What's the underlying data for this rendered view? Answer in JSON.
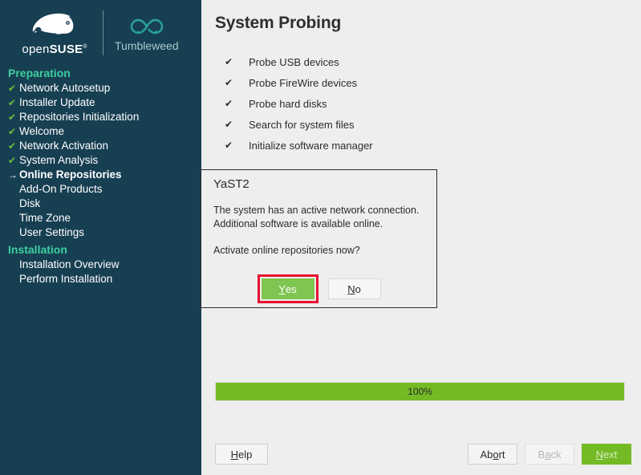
{
  "branding": {
    "product_name": "openSUSE",
    "product_name_light": "open",
    "product_name_bold": "SUSE",
    "edition": "Tumbleweed",
    "logo_icon": "opensuse-chameleon-icon",
    "edition_icon": "infinity-icon",
    "sidebar_bg": "#173f52",
    "accent_green": "#73ba25",
    "section_teal": "#3ecfa0"
  },
  "sidebar": {
    "sections": [
      {
        "label": "Preparation",
        "items": [
          {
            "label": "Network Autosetup",
            "state": "done",
            "mark": "✔"
          },
          {
            "label": "Installer Update",
            "state": "done",
            "mark": "✔"
          },
          {
            "label": "Repositories Initialization",
            "state": "done",
            "mark": "✔"
          },
          {
            "label": "Welcome",
            "state": "done",
            "mark": "✔"
          },
          {
            "label": "Network Activation",
            "state": "done",
            "mark": "✔"
          },
          {
            "label": "System Analysis",
            "state": "done",
            "mark": "✔"
          },
          {
            "label": "Online Repositories",
            "state": "current",
            "mark": "→"
          },
          {
            "label": "Add-On Products",
            "state": "pending",
            "mark": ""
          },
          {
            "label": "Disk",
            "state": "pending",
            "mark": ""
          },
          {
            "label": "Time Zone",
            "state": "pending",
            "mark": ""
          },
          {
            "label": "User Settings",
            "state": "pending",
            "mark": ""
          }
        ]
      },
      {
        "label": "Installation",
        "items": [
          {
            "label": "Installation Overview",
            "state": "pending",
            "mark": ""
          },
          {
            "label": "Perform Installation",
            "state": "pending",
            "mark": ""
          }
        ]
      }
    ]
  },
  "main": {
    "title": "System Probing",
    "tasks": [
      {
        "label": "Probe USB devices",
        "mark": "✔"
      },
      {
        "label": "Probe FireWire devices",
        "mark": "✔"
      },
      {
        "label": "Probe hard disks",
        "mark": "✔"
      },
      {
        "label": "Search for system files",
        "mark": "✔"
      },
      {
        "label": "Initialize software manager",
        "mark": "✔"
      }
    ],
    "progress": {
      "label": "100%",
      "percent": 100
    }
  },
  "dialog": {
    "title": "YaST2",
    "message_line1": "The system has an active network connection.",
    "message_line2": "Additional software is available online.",
    "question": "Activate online repositories now?",
    "yes": {
      "mnemonic": "Y",
      "rest": "es"
    },
    "no": {
      "mnemonic": "N",
      "rest": "o"
    },
    "highlight_color": "#e8112d"
  },
  "footer": {
    "help": {
      "mnemonic": "H",
      "rest": "elp"
    },
    "abort": {
      "pre": "Ab",
      "mnemonic": "o",
      "rest": "rt"
    },
    "back": {
      "pre": "B",
      "mnemonic": "a",
      "rest": "ck"
    },
    "next": {
      "mnemonic": "N",
      "rest": "ext"
    }
  }
}
